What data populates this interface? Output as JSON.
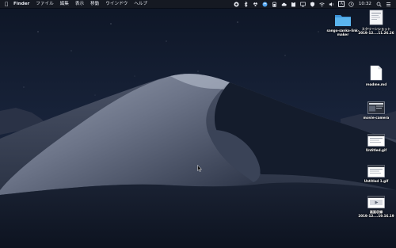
{
  "menubar": {
    "apple_icon": "apple-logo-icon",
    "app_name": "Finder",
    "items": [
      "ファイル",
      "編集",
      "表示",
      "移動",
      "ウインドウ",
      "ヘルプ"
    ],
    "status_icons": [
      "record-icon",
      "bluetooth-icon",
      "dropbox-icon",
      "sync-icon",
      "battery-icon",
      "cloud-icon",
      "clipboard-icon",
      "airplay-icon",
      "shield-icon",
      "wifi-icon",
      "volume-icon",
      "input-source-icon"
    ],
    "input_source": "A",
    "clock": "10:32",
    "right_icons": [
      "search-icon",
      "control-center-icon"
    ]
  },
  "desktop": {
    "icons": [
      {
        "label": "スクリーンショット\n2019-12....11.26.26",
        "kind": "screenshot"
      },
      {
        "label": "sango-sanko-link-\nmaker",
        "kind": "folder"
      },
      {
        "label": "readme.md",
        "kind": "document"
      },
      {
        "label": "movie-camera",
        "kind": "screenshot-dark"
      },
      {
        "label": "Untitled.gif",
        "kind": "gif"
      },
      {
        "label": "Untitled 1.gif",
        "kind": "gif"
      },
      {
        "label": "画面収録\n2019-12....19.16.19",
        "kind": "video"
      }
    ]
  },
  "colors": {
    "menubar_bg": "#161a22",
    "folder_blue": "#5ab4ee",
    "sky": "#0f1727",
    "dune_light": "#8a93a6"
  }
}
